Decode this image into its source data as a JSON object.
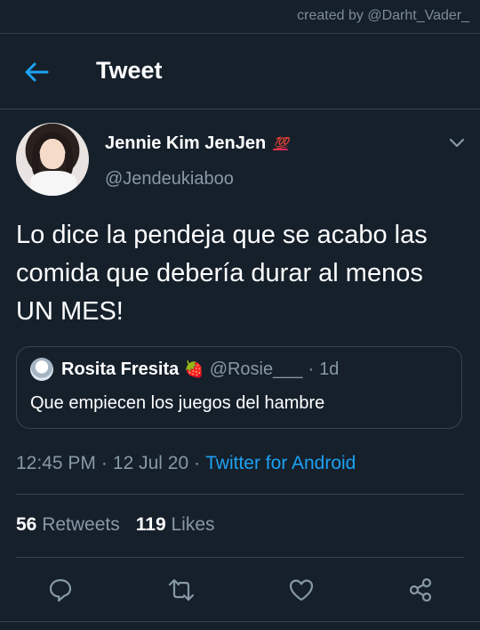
{
  "watermark": "created by @Darht_Vader_",
  "header": {
    "title": "Tweet",
    "back_icon": "arrow-left-icon"
  },
  "author": {
    "display_name": "Jennie Kim JenJen",
    "badge_emoji": "💯",
    "handle": "@Jendeukiaboo"
  },
  "tweet": {
    "text": "Lo dice la pendeja que se acabo las comida que debería durar al menos UN MES!",
    "time": "12:45 PM",
    "date": "12 Jul 20",
    "source": "Twitter for Android"
  },
  "quoted_tweet": {
    "display_name": "Rosita Fresita",
    "emoji": "🍓",
    "handle": "@Rosie___",
    "age": "1d",
    "text": "Que empiecen los juegos del hambre"
  },
  "stats": {
    "retweets_count": "56",
    "retweets_label": "Retweets",
    "likes_count": "119",
    "likes_label": "Likes"
  },
  "colors": {
    "background": "#15202b",
    "accent": "#1da1f2",
    "secondary_text": "#8899a6",
    "border": "#38444d"
  }
}
